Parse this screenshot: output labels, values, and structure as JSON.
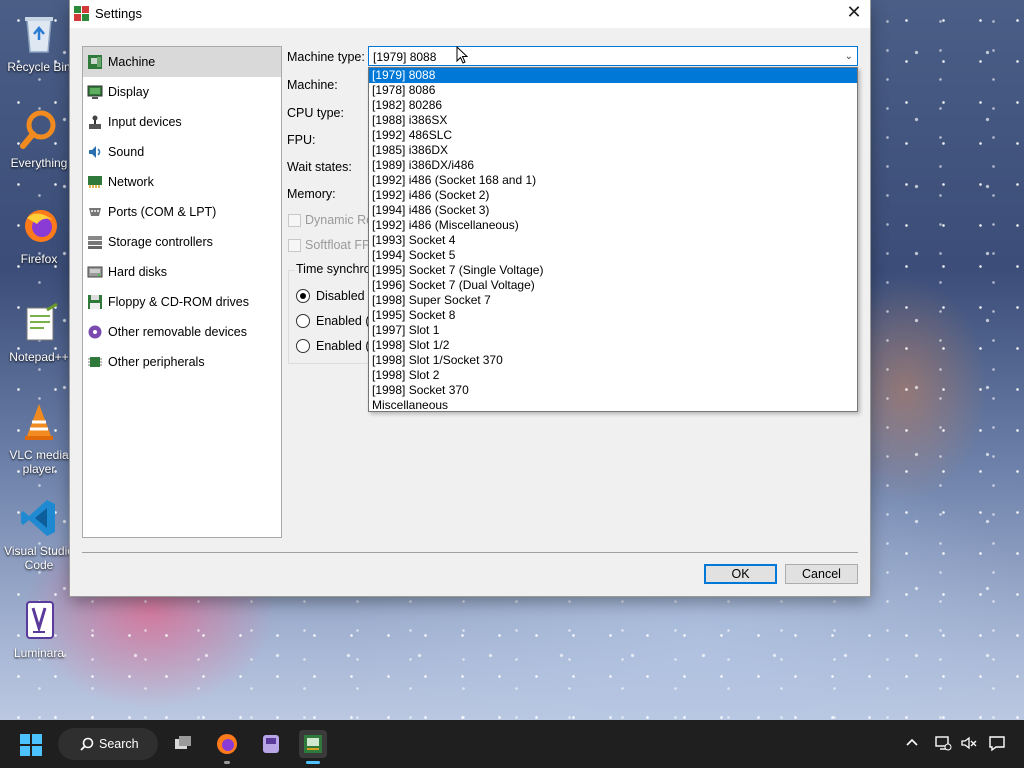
{
  "desktop": {
    "icons": [
      {
        "label": "Recycle Bin"
      },
      {
        "label": "Everything"
      },
      {
        "label": "Firefox"
      },
      {
        "label": "Notepad++"
      },
      {
        "label": "VLC media player"
      },
      {
        "label": "Visual Studio Code"
      },
      {
        "label": "Luminara"
      }
    ]
  },
  "dialog": {
    "title": "Settings",
    "categories": [
      {
        "label": "Machine",
        "icon": "motherboard-icon"
      },
      {
        "label": "Display",
        "icon": "monitor-icon"
      },
      {
        "label": "Input devices",
        "icon": "joystick-icon"
      },
      {
        "label": "Sound",
        "icon": "speaker-icon"
      },
      {
        "label": "Network",
        "icon": "network-icon"
      },
      {
        "label": "Ports (COM & LPT)",
        "icon": "port-icon"
      },
      {
        "label": "Storage controllers",
        "icon": "storage-icon"
      },
      {
        "label": "Hard disks",
        "icon": "hard-disk-icon"
      },
      {
        "label": "Floppy & CD-ROM drives",
        "icon": "floppy-icon"
      },
      {
        "label": "Other removable devices",
        "icon": "removable-icon"
      },
      {
        "label": "Other peripherals",
        "icon": "chip-icon"
      }
    ],
    "form": {
      "machine_type_label": "Machine type:",
      "machine_type_value": "[1979] 8088",
      "machine_label": "Machine:",
      "cpu_type_label": "CPU type:",
      "fpu_label": "FPU:",
      "wait_states_label": "Wait states:",
      "memory_label": "Memory:",
      "dynamic_recompiler_label": "Dynamic Re",
      "softfloat_label": "Softfloat FPU",
      "time_sync_title": "Time synchro",
      "time_sync_options": [
        "Disabled",
        "Enabled (l",
        "Enabled (U"
      ]
    },
    "machine_type_options": [
      "[1979] 8088",
      "[1978] 8086",
      "[1982] 80286",
      "[1988] i386SX",
      "[1992] 486SLC",
      "[1985] i386DX",
      "[1989] i386DX/i486",
      "[1992] i486 (Socket 168 and 1)",
      "[1992] i486 (Socket 2)",
      "[1994] i486 (Socket 3)",
      "[1992] i486 (Miscellaneous)",
      "[1993] Socket 4",
      "[1994] Socket 5",
      "[1995] Socket 7 (Single Voltage)",
      "[1996] Socket 7 (Dual Voltage)",
      "[1998] Super Socket 7",
      "[1995] Socket 8",
      "[1997] Slot 1",
      "[1998] Slot 1/2",
      "[1998] Slot 1/Socket 370",
      "[1998] Slot 2",
      "[1998] Socket 370",
      "Miscellaneous"
    ],
    "ok_label": "OK",
    "cancel_label": "Cancel"
  },
  "taskbar": {
    "search_label": "Search"
  },
  "colors": {
    "accent": "#0078d7",
    "taskbar": "#1f1f1f"
  }
}
